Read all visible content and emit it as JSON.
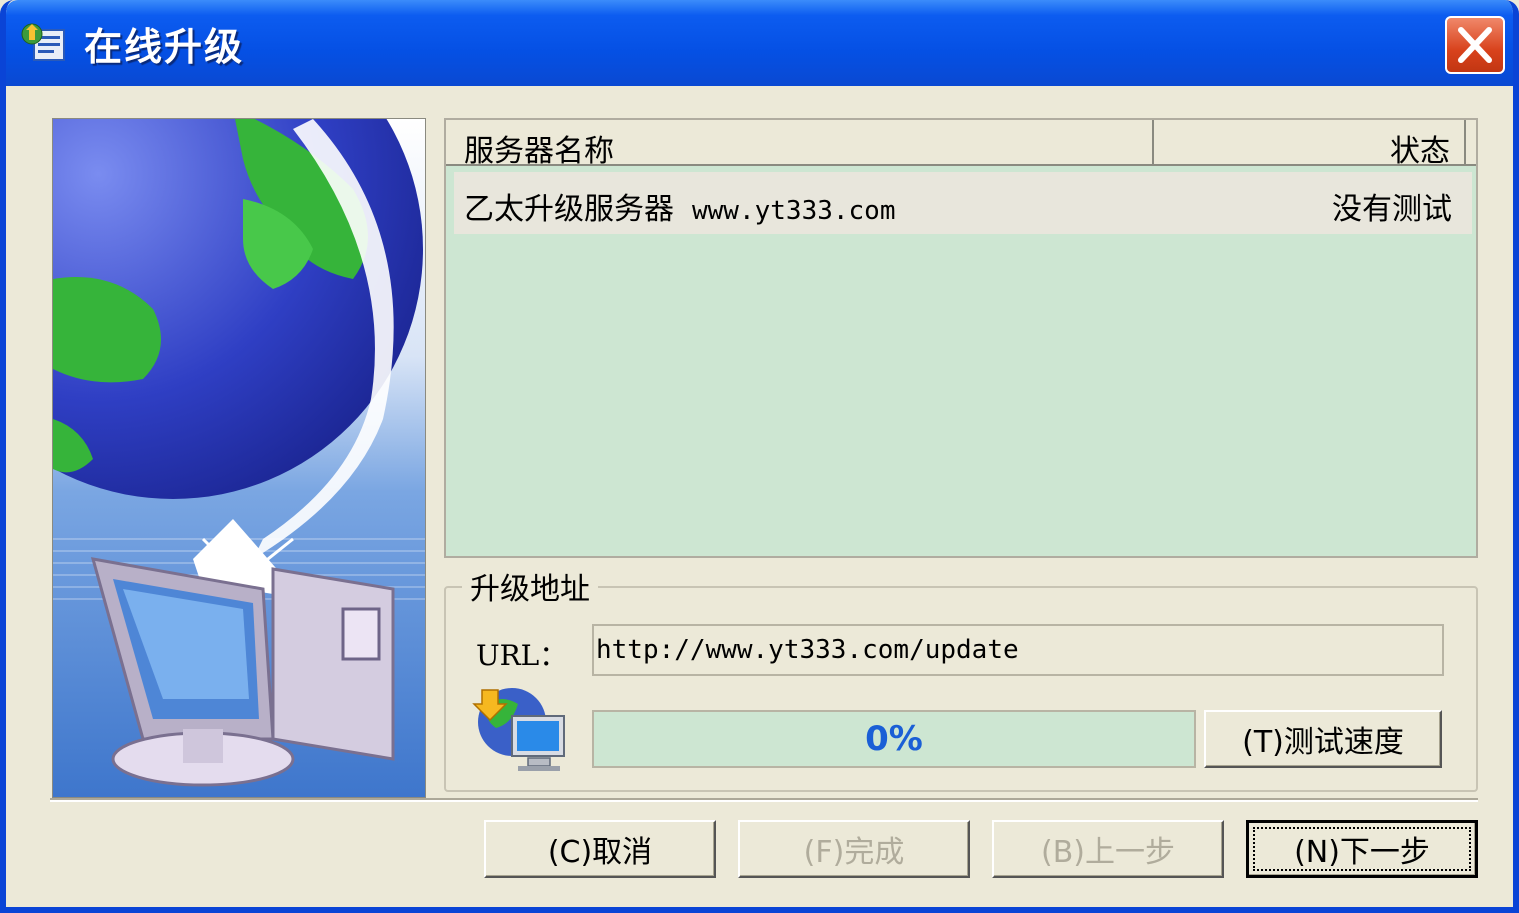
{
  "window": {
    "title": "在线升级",
    "close_label": "close"
  },
  "server_list": {
    "columns": [
      "服务器名称",
      "状态"
    ],
    "rows": [
      {
        "name": "乙太升级服务器",
        "url": "www.yt333.com",
        "status": "没有测试"
      }
    ]
  },
  "upgrade_address": {
    "legend": "升级地址",
    "url_label": "URL：",
    "url_value": "http://www.yt333.com/update",
    "progress_text": "0%",
    "progress_fraction": 0,
    "test_speed_label": "(T)测试速度"
  },
  "footer": {
    "cancel_label": "(C)取消",
    "finish_label": "(F)完成",
    "back_label": "(B)上一步",
    "next_label": "(N)下一步"
  },
  "colors": {
    "titlebar": "#0550e4",
    "list_background": "#cde6d2",
    "progress_text": "#1a5fd6",
    "dialog_background": "#ece9d8"
  }
}
